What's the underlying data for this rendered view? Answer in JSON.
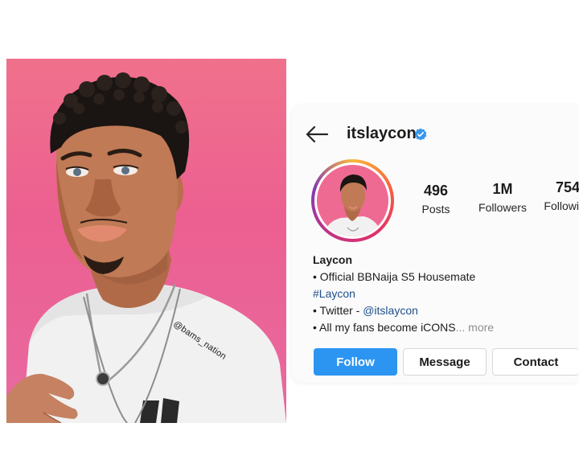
{
  "artwork": {
    "watermark": "@bams_nation"
  },
  "profile": {
    "username": "itslaycon",
    "verified": true,
    "stats": [
      {
        "value": "496",
        "label": "Posts"
      },
      {
        "value": "1M",
        "label": "Followers"
      },
      {
        "value": "754",
        "label": "Following"
      }
    ],
    "bio": {
      "name": "Laycon",
      "line1": "• Official BBNaija S5 Housemate",
      "hashtag": "#Laycon",
      "twitter_prefix": "• Twitter - ",
      "twitter_handle": "@itslaycon",
      "line4": "• All my fans become iCONS",
      "more": "... more"
    },
    "buttons": {
      "follow": "Follow",
      "message": "Message",
      "contact": "Contact"
    }
  },
  "colors": {
    "follow_button": "#2c95f2",
    "verified_badge": "#3897f0",
    "link_text": "#1f4f8a",
    "art_background": "#ec5f91"
  }
}
